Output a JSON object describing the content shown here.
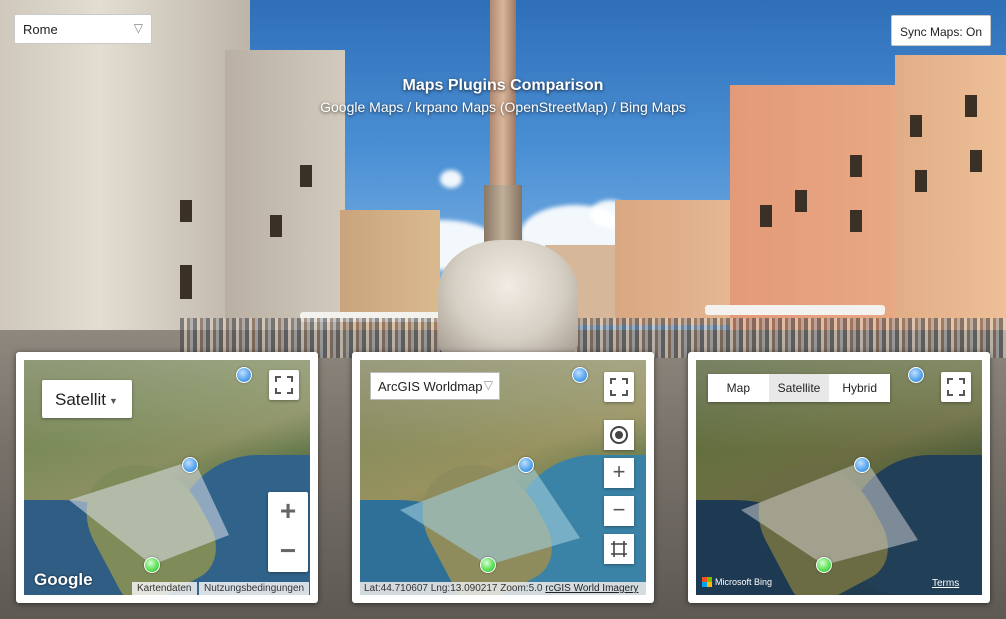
{
  "header": {
    "city_select": "Rome",
    "sync_button": "Sync Maps: On",
    "title": "Maps Plugins Comparison",
    "subtitle": "Google Maps / krpano Maps (OpenStreetMap) / Bing Maps"
  },
  "google": {
    "map_type": "Satellit",
    "zoom_in": "+",
    "zoom_out": "−",
    "logo": "Google",
    "footer_data": "Kartendaten",
    "footer_terms": "Nutzungsbedingungen"
  },
  "krpano": {
    "layer_select": "ArcGIS Worldmap",
    "zoom_in": "+",
    "zoom_out": "−",
    "status": "Lat:44.710607 Lng:13.090217 Zoom:5.0",
    "attribution": "rcGIS World Imagery"
  },
  "bing": {
    "types": [
      "Map",
      "Satellite",
      "Hybrid"
    ],
    "selected_type": "Satellite",
    "logo": "Microsoft Bing",
    "terms": "Terms"
  },
  "icons": {
    "dropdown": "chevron-down-icon",
    "fullscreen": "fullscreen-icon",
    "locate": "locate-icon",
    "fit": "fit-bounds-icon",
    "pano_marker": "blue-marker-icon",
    "spot_marker": "green-marker-icon"
  },
  "colors": {
    "marker_blue": "#5aa7ef",
    "marker_green": "#5fe05a"
  }
}
